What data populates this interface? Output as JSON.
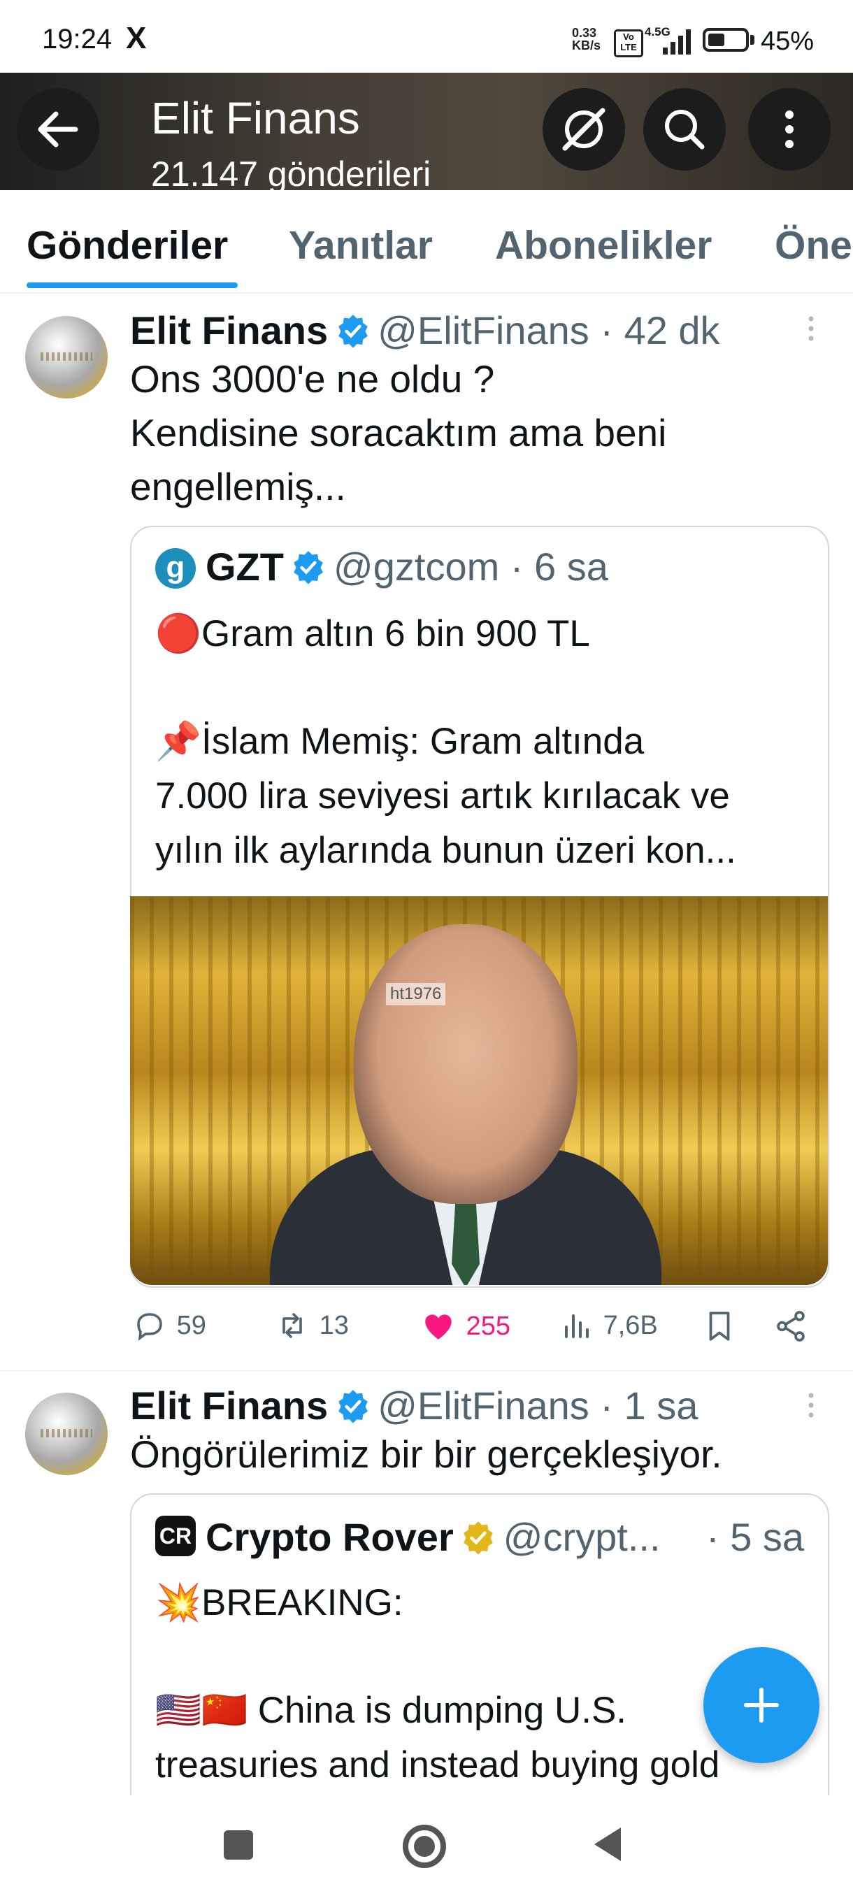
{
  "status_bar": {
    "time": "19:24",
    "x_icon": "X",
    "net_speed_value": "0.33",
    "net_speed_unit": "KB/s",
    "volte": "Vo LTE",
    "signal": "4.5G",
    "battery": "45%",
    "battery_level": 0.45
  },
  "header": {
    "title": "Elit Finans",
    "subtitle": "21.147 gönderileri",
    "icons": [
      "back-arrow-icon",
      "grok-icon",
      "search-icon",
      "more-vertical-icon"
    ]
  },
  "tabs": [
    {
      "label": "Gönderiler",
      "active": true
    },
    {
      "label": "Yanıtlar",
      "active": false
    },
    {
      "label": "Abonelikler",
      "active": false
    },
    {
      "label": "Öne",
      "active": false
    }
  ],
  "posts": [
    {
      "name": "Elit Finans",
      "handle": "@ElitFinans · 42 dk",
      "lines": [
        "Ons 3000'e ne oldu ?",
        "Kendisine soracaktım ama beni",
        "engellemiş..."
      ],
      "quote": {
        "logo": "g",
        "name": "GZT",
        "handle": "@gztcom · 6 sa",
        "lines": [
          "🔴Gram altın 6 bin 900 TL",
          "📌İslam Memiş: Gram altında",
          "7.000 lira seviyesi artık kırılacak ve",
          "yılın ilk aylarında bunun üzeri kon..."
        ],
        "image_tag": "ht1976"
      },
      "stats": {
        "replies": "59",
        "reposts": "13",
        "likes": "255",
        "views": "7,6B"
      }
    },
    {
      "name": "Elit Finans",
      "handle": "@ElitFinans · 1 sa",
      "lines": [
        "Öngörülerimiz bir bir gerçekleşiyor."
      ],
      "quote": {
        "logo": "CR",
        "name": "Crypto Rover",
        "handle": "@crypt...",
        "time": "· 5 sa",
        "lines": [
          "💥BREAKING:",
          "🇺🇸🇨🇳 China is dumping U.S.",
          "treasuries and instead buying gold"
        ]
      }
    }
  ],
  "fab_icon": "plus-icon",
  "colors": {
    "accent": "#1d9bf0",
    "like": "#f91880",
    "muted": "#536471",
    "gold_check": "#e2b719"
  }
}
